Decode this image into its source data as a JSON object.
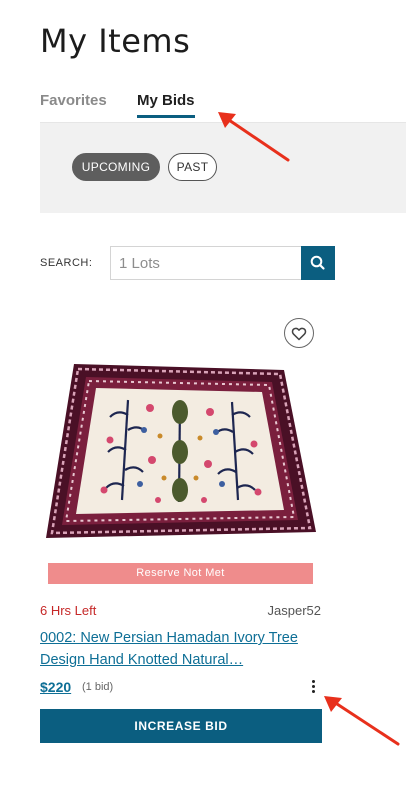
{
  "page": {
    "title": "My Items"
  },
  "tabs": [
    {
      "label": "Favorites",
      "active": false
    },
    {
      "label": "My Bids",
      "active": true
    }
  ],
  "filters": {
    "upcoming_label": "UPCOMING",
    "past_label": "PAST",
    "selected": "UPCOMING"
  },
  "search": {
    "label": "SEARCH:",
    "placeholder": "1 Lots",
    "icon": "search-icon"
  },
  "lot": {
    "reserve_status": "Reserve Not Met",
    "time_left": "6 Hrs Left",
    "seller": "Jasper52",
    "title": "0002: New Persian Hamadan Ivory Tree Design Hand Knotted Natural…",
    "price": "$220",
    "bid_count": "(1 bid)",
    "action_label": "INCREASE BID",
    "favorite_icon": "heart-icon",
    "more_icon": "more-vertical-icon"
  },
  "colors": {
    "accent": "#0b5e80",
    "link": "#0e6f96",
    "time_left": "#c62828",
    "reserve_banner": "#ef8c8c",
    "annotation_arrow": "#e8301c"
  }
}
